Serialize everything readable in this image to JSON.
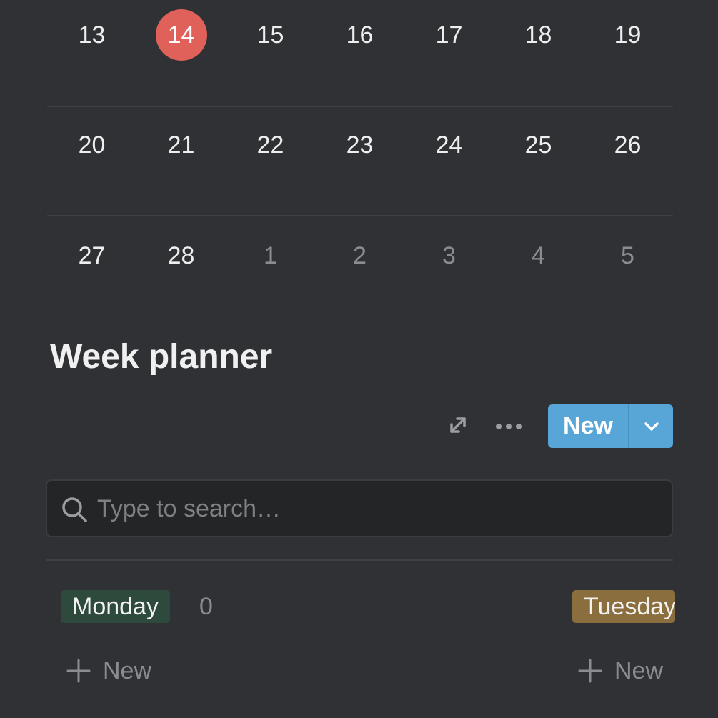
{
  "calendar": {
    "weeks": [
      [
        {
          "day": "13",
          "muted": false,
          "today": false
        },
        {
          "day": "14",
          "muted": false,
          "today": true
        },
        {
          "day": "15",
          "muted": false,
          "today": false
        },
        {
          "day": "16",
          "muted": false,
          "today": false
        },
        {
          "day": "17",
          "muted": false,
          "today": false
        },
        {
          "day": "18",
          "muted": false,
          "today": false
        },
        {
          "day": "19",
          "muted": false,
          "today": false
        }
      ],
      [
        {
          "day": "20",
          "muted": false,
          "today": false
        },
        {
          "day": "21",
          "muted": false,
          "today": false
        },
        {
          "day": "22",
          "muted": false,
          "today": false
        },
        {
          "day": "23",
          "muted": false,
          "today": false
        },
        {
          "day": "24",
          "muted": false,
          "today": false
        },
        {
          "day": "25",
          "muted": false,
          "today": false
        },
        {
          "day": "26",
          "muted": false,
          "today": false
        }
      ],
      [
        {
          "day": "27",
          "muted": false,
          "today": false
        },
        {
          "day": "28",
          "muted": false,
          "today": false
        },
        {
          "day": "1",
          "muted": true,
          "today": false
        },
        {
          "day": "2",
          "muted": true,
          "today": false
        },
        {
          "day": "3",
          "muted": true,
          "today": false
        },
        {
          "day": "4",
          "muted": true,
          "today": false
        },
        {
          "day": "5",
          "muted": true,
          "today": false
        }
      ]
    ],
    "today_color": "#e0605a"
  },
  "section": {
    "title": "Week planner"
  },
  "toolbar": {
    "expand_icon": "expand-arrows-icon",
    "more_icon": "more-horizontal-icon",
    "new_label": "New",
    "new_color": "#58a6d8"
  },
  "search": {
    "placeholder": "Type to search…",
    "value": ""
  },
  "board": {
    "columns": [
      {
        "label": "Monday",
        "count": "0",
        "color": "#2e4a3c",
        "add_label": "New"
      },
      {
        "label": "Tuesday",
        "color": "#8a6e3e",
        "add_label": "New"
      }
    ]
  }
}
